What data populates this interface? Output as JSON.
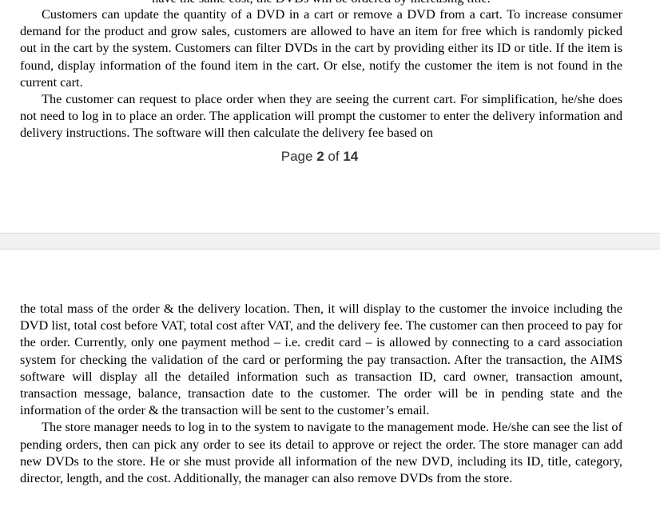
{
  "top_page": {
    "cut_line": "have the same cost, the DVDs will be ordered by increasing title.",
    "paragraphs": [
      "Customers can update the quantity of a DVD in a cart or remove a DVD from a cart. To increase consumer demand for the product and grow sales, customers are allowed to have an item for free which is randomly picked out in the cart by the system. Customers can filter DVDs in the cart by providing either its ID or title. If the item is found, display information of the found item in the cart. Or else, notify the customer the item is not found in the current cart.",
      "The customer can request to place order when they are seeing the current cart. For simplification, he/she does not need to log in to place an order. The application will prompt the customer to enter the delivery information and delivery instructions. The software will then calculate the delivery fee based on"
    ],
    "page_label": {
      "word": "Page",
      "current": "2",
      "of": "of",
      "total": "14"
    }
  },
  "bottom_page": {
    "paragraphs": [
      "the total mass of the order & the delivery location. Then, it will display to the customer the invoice including the DVD list, total cost before VAT, total cost after VAT, and the delivery fee. The customer can then proceed to pay for the order. Currently, only one payment method – i.e. credit card – is allowed by connecting to a card association system for checking the validation of the card or performing the pay transaction. After the transaction, the AIMS software will display all the detailed information such as transaction ID, card owner, transaction amount, transaction message, balance, transaction date to the customer. The order will be in pending state and the information of the order & the transaction will be sent to the customer’s email.",
      "The store manager needs to log in to the system to navigate to the management mode. He/she can see the list of pending orders, then can pick any order to see its detail to approve or reject the order. The store manager can add new DVDs to the store. He or she must provide all information of the new DVD, including its ID, title, category, director, length, and the cost. Additionally, the manager can also remove DVDs from the store."
    ]
  }
}
